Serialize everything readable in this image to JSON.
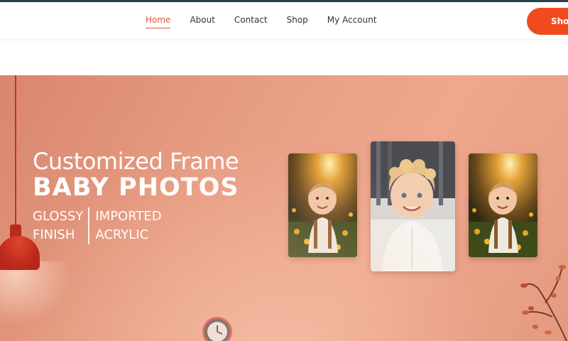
{
  "nav": {
    "items": [
      {
        "label": "Home",
        "active": true
      },
      {
        "label": "About",
        "active": false
      },
      {
        "label": "Contact",
        "active": false
      },
      {
        "label": "Shop",
        "active": false
      },
      {
        "label": "My Account",
        "active": false
      }
    ],
    "cta_label": "Shop"
  },
  "hero": {
    "line1": "Customized Frame",
    "line2": "BABY PHOTOS",
    "feature_left": [
      "GLOSSY",
      "FINISH"
    ],
    "feature_right": [
      "IMPORTED",
      "ACRYLIC"
    ]
  },
  "colors": {
    "accent": "#f04a1e",
    "active_nav": "#e8502f",
    "hero_bg": "#e69c82",
    "topbar": "#27424a"
  },
  "icons": [
    "pendant-lamp",
    "wall-clock",
    "autumn-branch"
  ]
}
